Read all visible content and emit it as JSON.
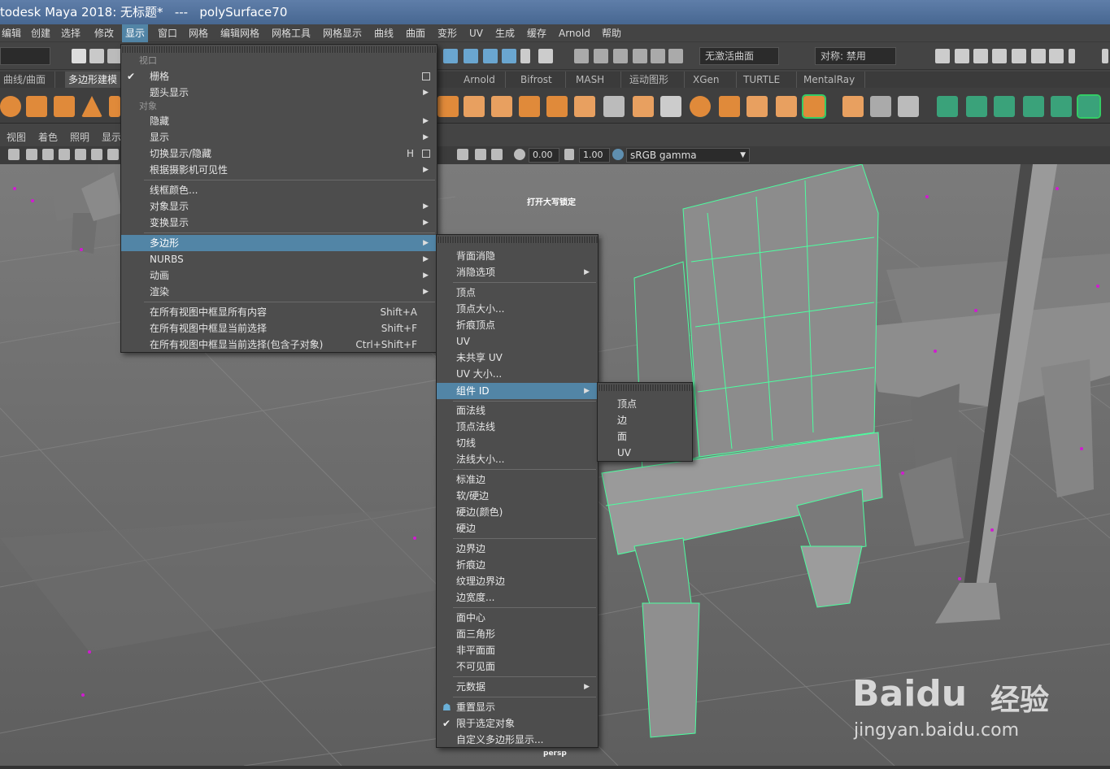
{
  "window": {
    "title": "todesk Maya 2018: 无标题*   ---   polySurface70"
  },
  "menubar": {
    "items": [
      "编辑",
      "创建",
      "选择",
      "修改",
      "显示",
      "窗口",
      "网格",
      "编辑网格",
      "网格工具",
      "网格显示",
      "曲线",
      "曲面",
      "变形",
      "UV",
      "生成",
      "缓存",
      "Arnold",
      "帮助"
    ],
    "active": "显示"
  },
  "toolbar": {
    "surface_field": "无激活曲面",
    "symmetry_field": "对称: 禁用"
  },
  "shelf": {
    "tabs": [
      "曲线/曲面",
      "多边形建模",
      "Arnold",
      "Bifrost",
      "MASH",
      "运动图形",
      "XGen",
      "TURTLE",
      "MentalRay"
    ],
    "selected": "多边形建模"
  },
  "panel": {
    "menu": [
      "视图",
      "着色",
      "照明",
      "显示"
    ],
    "value1": "0.00",
    "value2": "1.00",
    "colorspace": "sRGB gamma"
  },
  "viewport": {
    "hud_caps": "打开大写锁定",
    "camera": "persp"
  },
  "display_menu": {
    "section_viewport": "视口",
    "grid": "栅格",
    "hud": "题头显示",
    "section_object": "对象",
    "hide": "隐藏",
    "show": "显示",
    "toggle": "切换显示/隐藏",
    "toggle_shortcut": "H",
    "camera_vis": "根据摄影机可见性",
    "wire_color": "线框颜色...",
    "object_display": "对象显示",
    "transform_display": "变换显示",
    "polygon": "多边形",
    "nurbs": "NURBS",
    "animation": "动画",
    "render": "渲染",
    "frame_all": "在所有视图中框显所有内容",
    "frame_all_sc": "Shift+A",
    "frame_sel": "在所有视图中框显当前选择",
    "frame_sel_sc": "Shift+F",
    "frame_sel_child": "在所有视图中框显当前选择(包含子对象)",
    "frame_sel_child_sc": "Ctrl+Shift+F"
  },
  "polygon_menu": {
    "items": [
      "背面消隐",
      "消隐选项",
      "顶点",
      "顶点大小...",
      "折痕顶点",
      "UV",
      "未共享 UV",
      "UV 大小...",
      "组件 ID",
      "面法线",
      "顶点法线",
      "切线",
      "法线大小...",
      "标准边",
      "软/硬边",
      "硬边(颜色)",
      "硬边",
      "边界边",
      "折痕边",
      "纹理边界边",
      "边宽度...",
      "面中心",
      "面三角形",
      "非平面面",
      "不可见面",
      "元数据",
      "重置显示",
      "限于选定对象",
      "自定义多边形显示..."
    ]
  },
  "component_id_menu": {
    "items": [
      "顶点",
      "边",
      "面",
      "UV"
    ]
  },
  "watermark": {
    "brand": "Baidu",
    "brand_cn": "经验",
    "url": "jingyan.baidu.com"
  }
}
